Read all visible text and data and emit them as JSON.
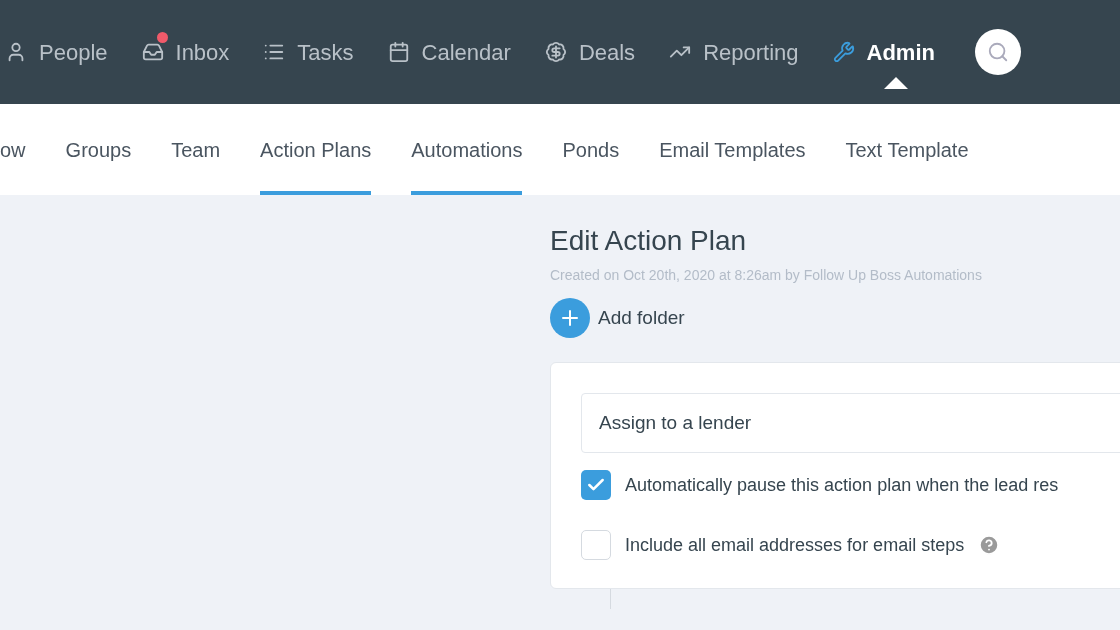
{
  "nav": [
    {
      "kind": "people",
      "label": "People",
      "selected": false,
      "unread": false
    },
    {
      "kind": "inbox",
      "label": "Inbox",
      "selected": false,
      "unread": true
    },
    {
      "kind": "tasks",
      "label": "Tasks",
      "selected": false,
      "unread": false
    },
    {
      "kind": "calendar",
      "label": "Calendar",
      "selected": false,
      "unread": false
    },
    {
      "kind": "deals",
      "label": "Deals",
      "selected": false,
      "unread": false
    },
    {
      "kind": "reporting",
      "label": "Reporting",
      "selected": false,
      "unread": false
    },
    {
      "kind": "admin",
      "label": "Admin",
      "selected": true,
      "unread": false
    }
  ],
  "tabs": [
    {
      "label": "ow",
      "selected": false
    },
    {
      "label": "Groups",
      "selected": false
    },
    {
      "label": "Team",
      "selected": false
    },
    {
      "label": "Action Plans",
      "selected": true
    },
    {
      "label": "Automations",
      "selected": true
    },
    {
      "label": "Ponds",
      "selected": false
    },
    {
      "label": "Email Templates",
      "selected": false
    },
    {
      "label": "Text Template",
      "selected": false
    }
  ],
  "page": {
    "title": "Edit Action Plan",
    "subtitle": "Created on Oct 20th, 2020 at 8:26am by Follow Up Boss Automations",
    "add_folder": "Add folder"
  },
  "form": {
    "name_value": "Assign to a lender",
    "options": [
      {
        "label": "Automatically pause this action plan when the lead res",
        "checked": true,
        "help": false
      },
      {
        "label": "Include all email addresses for email steps",
        "checked": false,
        "help": true
      }
    ]
  }
}
